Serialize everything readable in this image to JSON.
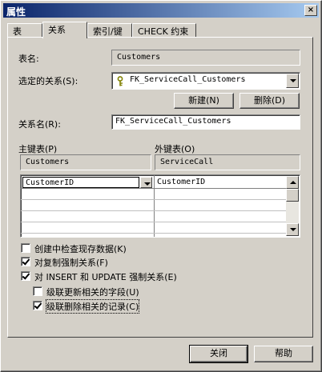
{
  "window": {
    "title": "属性",
    "close_glyph": "×"
  },
  "tabs": [
    {
      "label": "表"
    },
    {
      "label": "关系"
    },
    {
      "label": "索引/键"
    },
    {
      "label": "CHECK 约束"
    }
  ],
  "table_name": {
    "label": "表名:",
    "value": "Customers"
  },
  "selected_relationship": {
    "label": "选定的关系(S):",
    "value": "FK_ServiceCall_Customers",
    "icon": "key-icon"
  },
  "buttons": {
    "new": "新建(N)",
    "delete": "删除(D)",
    "close": "关闭",
    "help": "帮助"
  },
  "relationship_name": {
    "label": "关系名(R):",
    "value": "FK_ServiceCall_Customers"
  },
  "primary_key_table": {
    "label": "主键表(P)",
    "value": "Customers"
  },
  "foreign_key_table": {
    "label": "外键表(O)",
    "value": "ServiceCall"
  },
  "key_columns": [
    {
      "primary": "CustomerID",
      "foreign": "CustomerID"
    }
  ],
  "options": [
    {
      "label": "创建中检查现存数据(K)",
      "checked": false
    },
    {
      "label": "对复制强制关系(F)",
      "checked": true
    },
    {
      "label": "对 INSERT 和 UPDATE 强制关系(E)",
      "checked": true
    },
    {
      "label": "级联更新相关的字段(U)",
      "checked": false
    },
    {
      "label": "级联删除相关的记录(C)",
      "checked": true
    }
  ]
}
